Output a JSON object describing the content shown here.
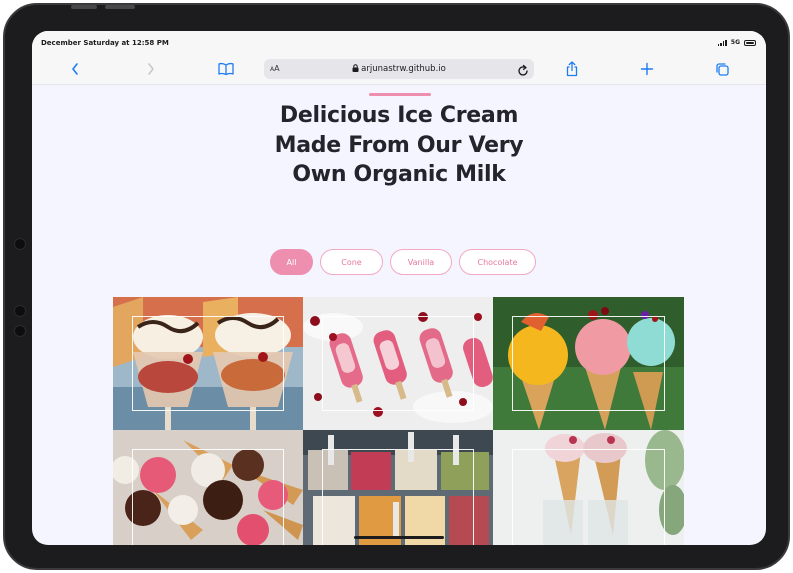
{
  "status_bar": {
    "time": "December Saturday at 12:58 PM",
    "network": "5G",
    "battery_percent": 100
  },
  "browser": {
    "text_size_label": "AA",
    "url": "arjunastrw.github.io",
    "icons": [
      "back-chevron-icon",
      "forward-chevron-icon",
      "bookmarks-book-icon",
      "lock-icon",
      "reload-icon",
      "share-icon",
      "new-tab-plus-icon",
      "tabs-icon"
    ]
  },
  "page": {
    "heading": "Delicious Ice Cream Made From Our Very Own Organic Milk",
    "filters": [
      {
        "label": "All",
        "active": true
      },
      {
        "label": "Cone",
        "active": false
      },
      {
        "label": "Vanilla",
        "active": false
      },
      {
        "label": "Chocolate",
        "active": false
      }
    ],
    "gallery": [
      {
        "subject": "ice cream sundae glasses"
      },
      {
        "subject": "pink popsicles with cherries"
      },
      {
        "subject": "colorful gelato cones"
      },
      {
        "subject": "chocolate dipped cones"
      },
      {
        "subject": "gelato display trays"
      },
      {
        "subject": "strawberry cones in glasses"
      }
    ],
    "scroll_top_icon": "double-chevron-up-icon"
  },
  "colors": {
    "accent_pink": "#ee8fb0",
    "page_background": "#f4f5ff",
    "heading_text": "#24242b",
    "scroll_button": "#5fb6dc"
  }
}
